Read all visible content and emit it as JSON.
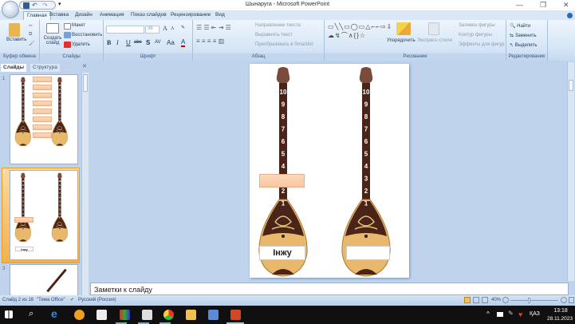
{
  "window": {
    "title": "Шынаруга - Microsoft PowerPoint",
    "minimize": "—",
    "restore": "❐",
    "close": "✕"
  },
  "tabs": [
    "Главная",
    "Вставка",
    "Дизайн",
    "Анимация",
    "Показ слайдов",
    "Рецензирование",
    "Вид"
  ],
  "ribbon": {
    "clipboard": {
      "label": "Буфер обмена",
      "paste": "Вставить"
    },
    "slides": {
      "label": "Слайды",
      "new_slide": "Создать слайд",
      "layout": "Макет",
      "reset": "Восстановить",
      "delete": "Удалить"
    },
    "font": {
      "label": "Шрифт",
      "font_name": "",
      "font_size": "36",
      "bold": "B",
      "italic": "I",
      "underline": "U",
      "strike": "abc",
      "shadow": "S",
      "spacing": "AV",
      "case": "Aa",
      "color": "A",
      "grow": "A",
      "shrink": "A"
    },
    "paragraph": {
      "label": "Абзац",
      "direction": "Направление текста",
      "align": "Выровнять текст",
      "smartart": "Преобразовать в SmartArt"
    },
    "drawing": {
      "label": "Рисование",
      "arrange": "Упорядочить",
      "quick_styles": "Экспресс-стили",
      "fill": "Заливка фигуры",
      "outline": "Контур фигуры",
      "effects": "Эффекты для фигур",
      "shapes": "▭╲╲▭◯▭△⌐⌐⇨⇩☁↯⌒∧{}☆"
    },
    "editing": {
      "label": "Редактирование",
      "find": "Найти",
      "replace": "Заменить",
      "select": "Выделить"
    }
  },
  "panel": {
    "tab_slides": "Слайды",
    "tab_outline": "Структура",
    "close": "✕",
    "slide_numbers": [
      "1",
      "2",
      "3"
    ],
    "selected_slide": 2
  },
  "slide": {
    "frets": [
      "10",
      "9",
      "8",
      "7",
      "6",
      "5",
      "4",
      "3",
      "2",
      "1"
    ],
    "left_label": "Інжу",
    "right_label": "",
    "thumb2_label": "Інжу"
  },
  "notes": {
    "placeholder": "Заметки к слайду"
  },
  "status": {
    "slide_info": "Слайд 2 из 16",
    "theme": "\"Тема Office\"",
    "language": "Русский (Россия)",
    "zoom": "40%"
  },
  "taskbar": {
    "language": "ҚАЗ",
    "time": "13:18",
    "date": "28.11.2023"
  },
  "colors": {
    "ribbon": "#d6e5f6",
    "selected_thumb": "#f5b04a",
    "dombra_wood": "#e8b86c",
    "dombra_dark": "#4a2418",
    "taskbar": "#101010"
  }
}
